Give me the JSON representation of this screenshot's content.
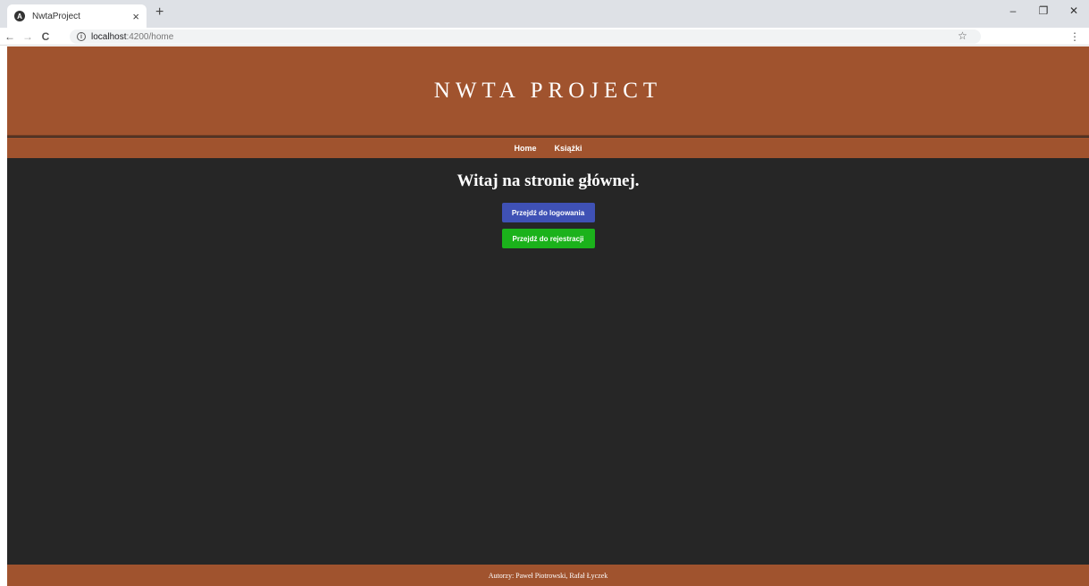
{
  "browser": {
    "tab": {
      "title": "NwtaProject",
      "favicon": "A",
      "close": "×"
    },
    "new_tab": "+",
    "window_controls": {
      "minimize": "–",
      "restore": "❐",
      "close": "✕"
    },
    "nav": {
      "back": "←",
      "forward": "→",
      "reload": "C"
    },
    "url": {
      "host": "localhost",
      "path": ":4200/home"
    },
    "star": "☆",
    "menu": "⋮"
  },
  "header": {
    "title": "NWTA PROJECT"
  },
  "navbar": {
    "items": [
      {
        "label": "Home"
      },
      {
        "label": "Książki"
      }
    ]
  },
  "main": {
    "welcome": "Witaj na stronie głównej.",
    "login_button": "Przejdź do logowania",
    "register_button": "Przejdź do rejestracji"
  },
  "footer": {
    "text": "Autorzy: Paweł Piotrowski, Rafał Łyczek"
  },
  "colors": {
    "brand": "#a0532e",
    "background": "#262626",
    "login_button": "#3f51b5",
    "register_button": "#1bb21b"
  }
}
